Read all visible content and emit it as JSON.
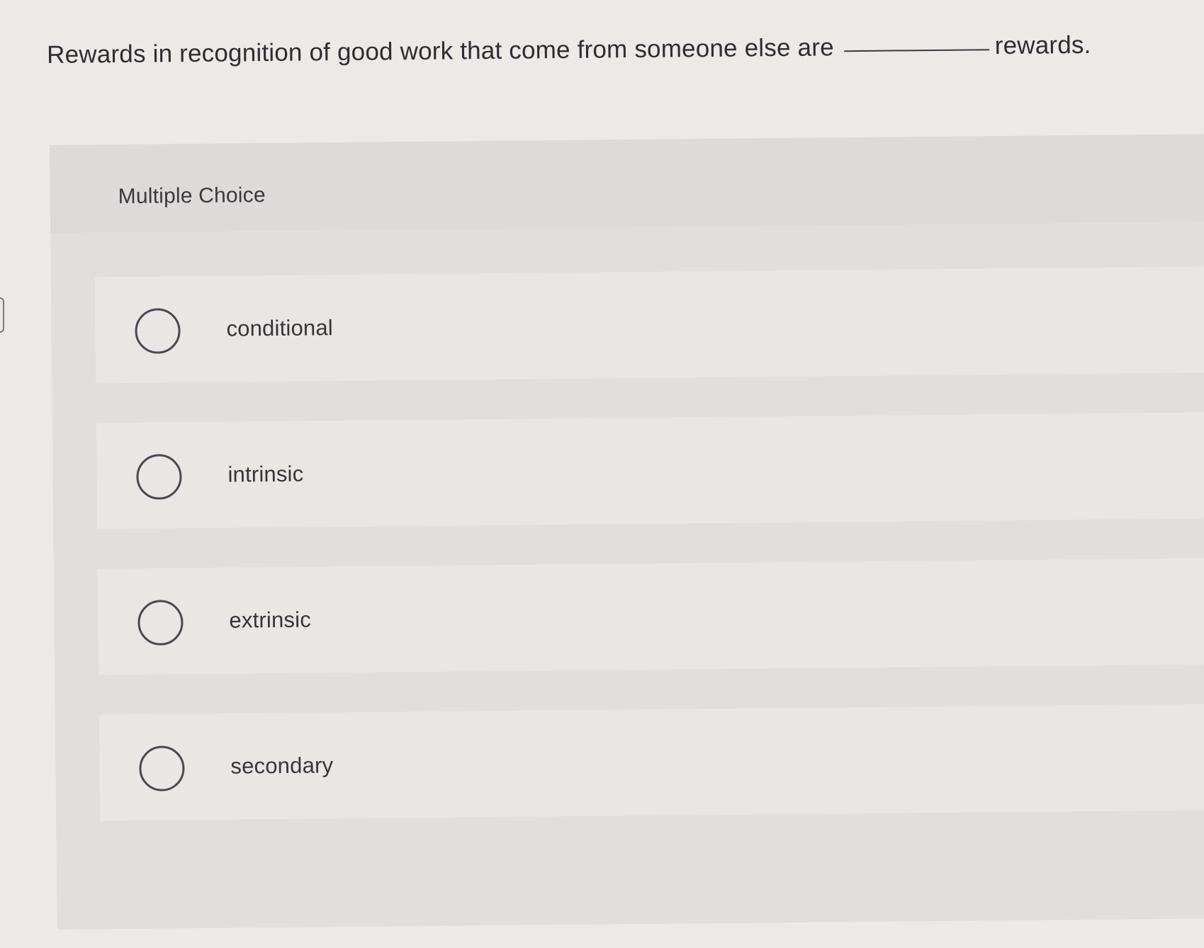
{
  "question": {
    "text_before": "Rewards in recognition of good work that come from someone else are",
    "text_after": "rewards."
  },
  "multiple_choice": {
    "title": "Multiple Choice",
    "options": [
      {
        "label": "conditional",
        "selected": false
      },
      {
        "label": "intrinsic",
        "selected": false
      },
      {
        "label": "extrinsic",
        "selected": false
      },
      {
        "label": "secondary",
        "selected": false
      }
    ]
  },
  "colors": {
    "page_background": "#eceae6",
    "panel_background": "#e0dfdd",
    "option_background": "#e8e7e4",
    "text": "#2e2d33",
    "radio_border": "#4a4850"
  },
  "icons": {
    "radio": "radio-button-empty-icon"
  }
}
